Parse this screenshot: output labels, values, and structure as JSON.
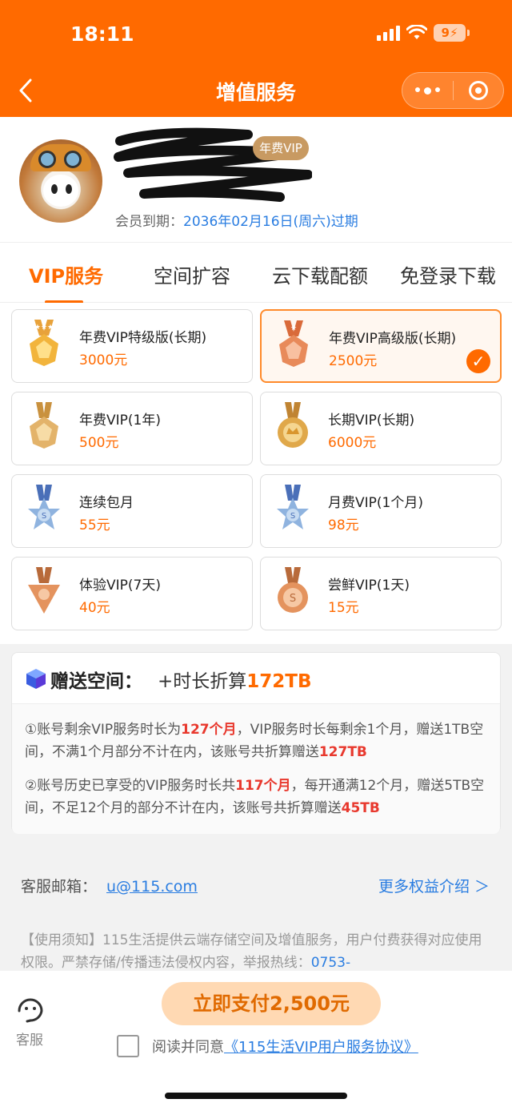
{
  "status_bar": {
    "time": "18:11",
    "battery": "9"
  },
  "nav": {
    "title": "增值服务"
  },
  "profile": {
    "vip_tag": "年费VIP",
    "expiry_label": "会员到期：",
    "expiry_date": "2036年02月16日(周六)过期"
  },
  "tabs": [
    {
      "label": "VIP服务",
      "active": true
    },
    {
      "label": "空间扩容",
      "active": false
    },
    {
      "label": "云下载配额",
      "active": false
    },
    {
      "label": "免登录下载",
      "active": false
    }
  ],
  "plans": [
    {
      "name": "年费VIP特级版(长期)",
      "price": "3000元",
      "selected": false,
      "medal": "gold-star-medal-icon"
    },
    {
      "name": "年费VIP高级版(长期)",
      "price": "2500元",
      "selected": true,
      "medal": "bronze-star-medal-icon"
    },
    {
      "name": "年费VIP(1年)",
      "price": "500元",
      "selected": false,
      "medal": "gold-shield-medal-icon"
    },
    {
      "name": "长期VIP(长期)",
      "price": "6000元",
      "selected": false,
      "medal": "gold-crown-medal-icon"
    },
    {
      "name": "连续包月",
      "price": "55元",
      "selected": false,
      "medal": "silver-star-medal-icon"
    },
    {
      "name": "月费VIP(1个月)",
      "price": "98元",
      "selected": false,
      "medal": "silver-star-medal-icon"
    },
    {
      "name": "体验VIP(7天)",
      "price": "40元",
      "selected": false,
      "medal": "bronze-triangle-medal-icon"
    },
    {
      "name": "尝鲜VIP(1天)",
      "price": "15元",
      "selected": false,
      "medal": "bronze-round-medal-icon"
    }
  ],
  "gift": {
    "title": "赠送空间：",
    "calc_prefix": "+时长折算",
    "calc_value": "172TB",
    "p1": {
      "a": "①账号剩余VIP服务时长为",
      "b": "127个月",
      "c": "，VIP服务时长每剩余1个月，赠送1TB空间，不满1个月部分不计在内，该账号共折算赠送",
      "d": "127TB"
    },
    "p2": {
      "a": "②账号历史已享受的VIP服务时长共",
      "b": "117个月",
      "c": "，每开通满12个月，赠送5TB空间，不足12个月的部分不计在内，该账号共折算赠送",
      "d": "45TB"
    }
  },
  "contact": {
    "label": "客服邮箱：",
    "email": "u@115.com",
    "more": "更多权益介绍 ＞"
  },
  "notice": {
    "text": "【使用须知】115生活提供云端存储空间及增值服务，用户付费获得对应使用权限。严禁存储/传播违法侵权内容，举报热线：",
    "hotline": "0753-"
  },
  "bottom": {
    "service_label": "客服",
    "pay_label": "立即支付2,500元",
    "agree_text": "阅读并同意",
    "agree_link": "《115生活VIP用户服务协议》"
  },
  "colors": {
    "brand": "#ff6a00",
    "link": "#2a7de1",
    "highlight": "#e8382d"
  }
}
